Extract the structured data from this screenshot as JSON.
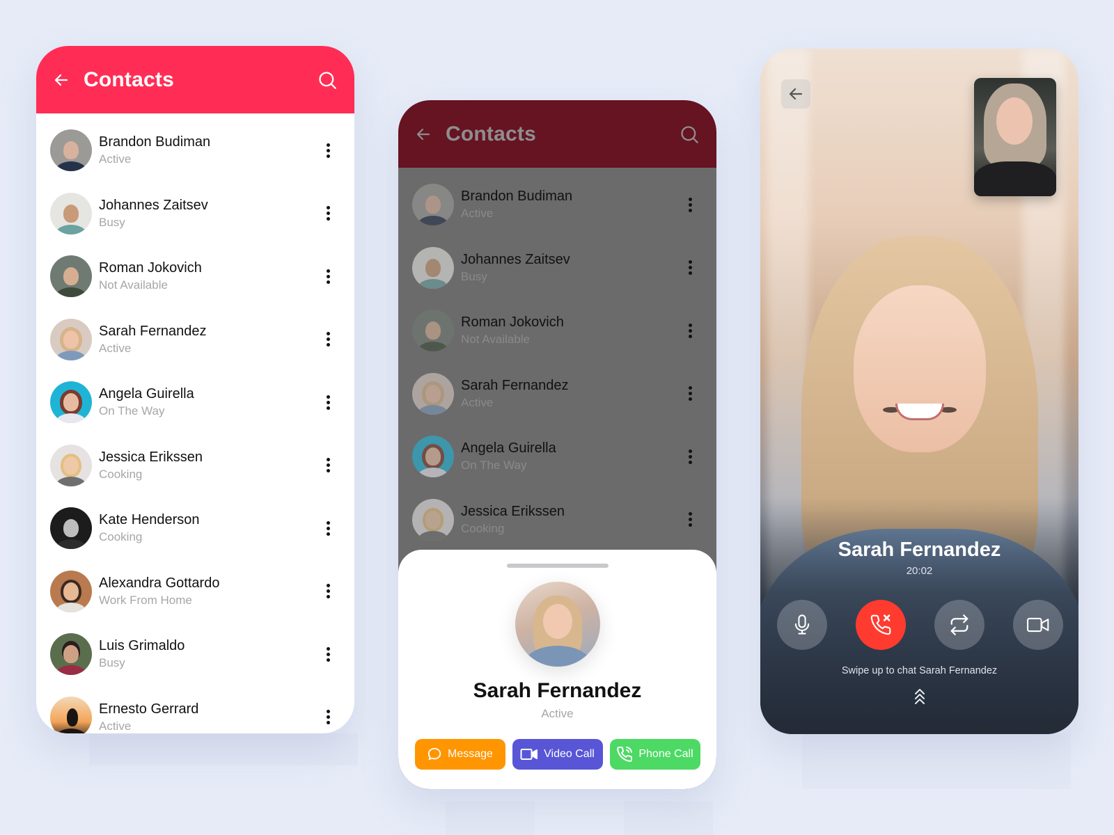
{
  "colors": {
    "background": "#e6ebf7",
    "header_red": "#ff2d55",
    "header_dimmed": "#661322",
    "message_button": "#ff9500",
    "video_call_button": "#5856d6",
    "phone_call_button": "#4cd964",
    "end_call": "#ff3b30"
  },
  "contacts_screen": {
    "title": "Contacts",
    "back_icon": "arrow-left-icon",
    "search_icon": "search-icon",
    "contacts": [
      {
        "name": "Brandon Budiman",
        "status": "Active"
      },
      {
        "name": "Johannes Zaitsev",
        "status": "Busy"
      },
      {
        "name": "Roman Jokovich",
        "status": "Not Available"
      },
      {
        "name": "Sarah Fernandez",
        "status": "Active"
      },
      {
        "name": "Angela Guirella",
        "status": "On The Way"
      },
      {
        "name": "Jessica Erikssen",
        "status": "Cooking"
      },
      {
        "name": "Kate Henderson",
        "status": "Cooking"
      },
      {
        "name": "Alexandra Gottardo",
        "status": "Work From Home"
      },
      {
        "name": "Luis Grimaldo",
        "status": "Busy"
      },
      {
        "name": "Ernesto Gerrard",
        "status": "Active"
      }
    ]
  },
  "contact_sheet_screen": {
    "title": "Contacts",
    "contacts": [
      {
        "name": "Brandon Budiman",
        "status": "Active"
      },
      {
        "name": "Johannes Zaitsev",
        "status": "Busy"
      },
      {
        "name": "Roman Jokovich",
        "status": "Not Available"
      },
      {
        "name": "Sarah Fernandez",
        "status": "Active"
      },
      {
        "name": "Angela Guirella",
        "status": "On The Way"
      },
      {
        "name": "Jessica Erikssen",
        "status": "Cooking"
      }
    ],
    "sheet": {
      "name": "Sarah Fernandez",
      "status": "Active",
      "actions": [
        {
          "label": "Message",
          "icon": "chat-bubble-icon"
        },
        {
          "label": "Video Call",
          "icon": "video-camera-icon"
        },
        {
          "label": "Phone Call",
          "icon": "phone-call-icon"
        }
      ]
    }
  },
  "video_call_screen": {
    "caller_name": "Sarah Fernandez",
    "call_duration": "20:02",
    "controls": [
      {
        "label": "Microphone",
        "icon": "microphone-icon"
      },
      {
        "label": "End Call",
        "icon": "phone-hangup-icon"
      },
      {
        "label": "Switch Camera",
        "icon": "switch-camera-icon"
      },
      {
        "label": "Video",
        "icon": "video-camera-icon"
      }
    ],
    "swipe_hint": "Swipe up to chat Sarah Fernandez"
  }
}
